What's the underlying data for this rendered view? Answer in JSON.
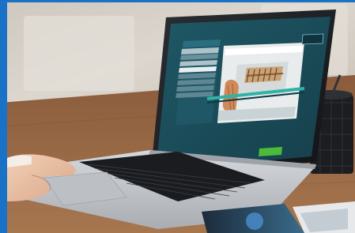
{
  "scene": {
    "colors": {
      "frame": "#1a72c6",
      "wall": "#d8d2cb",
      "desk": "#9a6a46",
      "laptop_body": "#c9ccd1",
      "screen_bg": "#1d4d59",
      "sidebar_bg": "#1f5766",
      "cta_green": "#4dbb3a"
    },
    "icons": [
      "pen-holder-icon",
      "laptop-icon",
      "hand-icon",
      "brochure-icon"
    ]
  },
  "laptop_screen": {
    "brand": "",
    "menu_items": [
      "",
      "",
      "",
      "",
      "",
      "",
      "",
      "",
      "",
      "",
      ""
    ],
    "cta_label": ""
  }
}
